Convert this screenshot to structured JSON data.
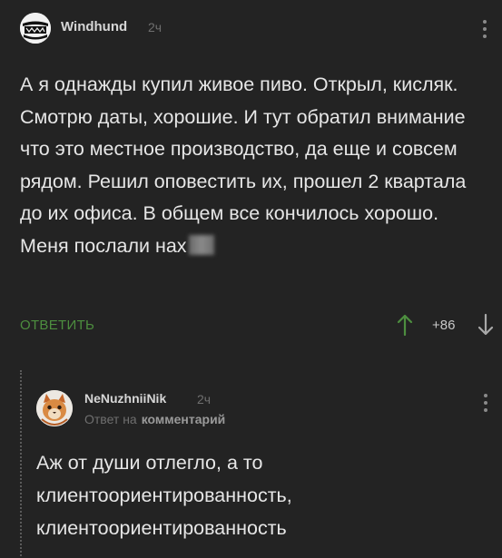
{
  "comment": {
    "username": "Windhund",
    "time": "2ч",
    "text": "А я однажды купил живое пиво. Открыл, кисляк. Смотрю даты, хорошие. И тут обратил внимание что это местное производство, да еще и совсем рядом. Решил оповестить их, прошел 2 квартала до их офиса. В общем все кончилось хорошо. Меня послали нах",
    "reply_label": "ОТВЕТИТЬ",
    "rating": "+86",
    "accent_color": "#4d8e3f"
  },
  "reply": {
    "username": "NeNuzhniiNik",
    "time": "2ч",
    "reply_to_prefix": "Ответ на",
    "reply_to_target": "комментарий",
    "text": "Аж от души отлегло, а то клиентоориентированность, клиентоориентированность"
  },
  "icons": {
    "vote_up": "arrow-up-icon",
    "vote_down": "arrow-down-icon",
    "more": "more-vertical-icon"
  }
}
